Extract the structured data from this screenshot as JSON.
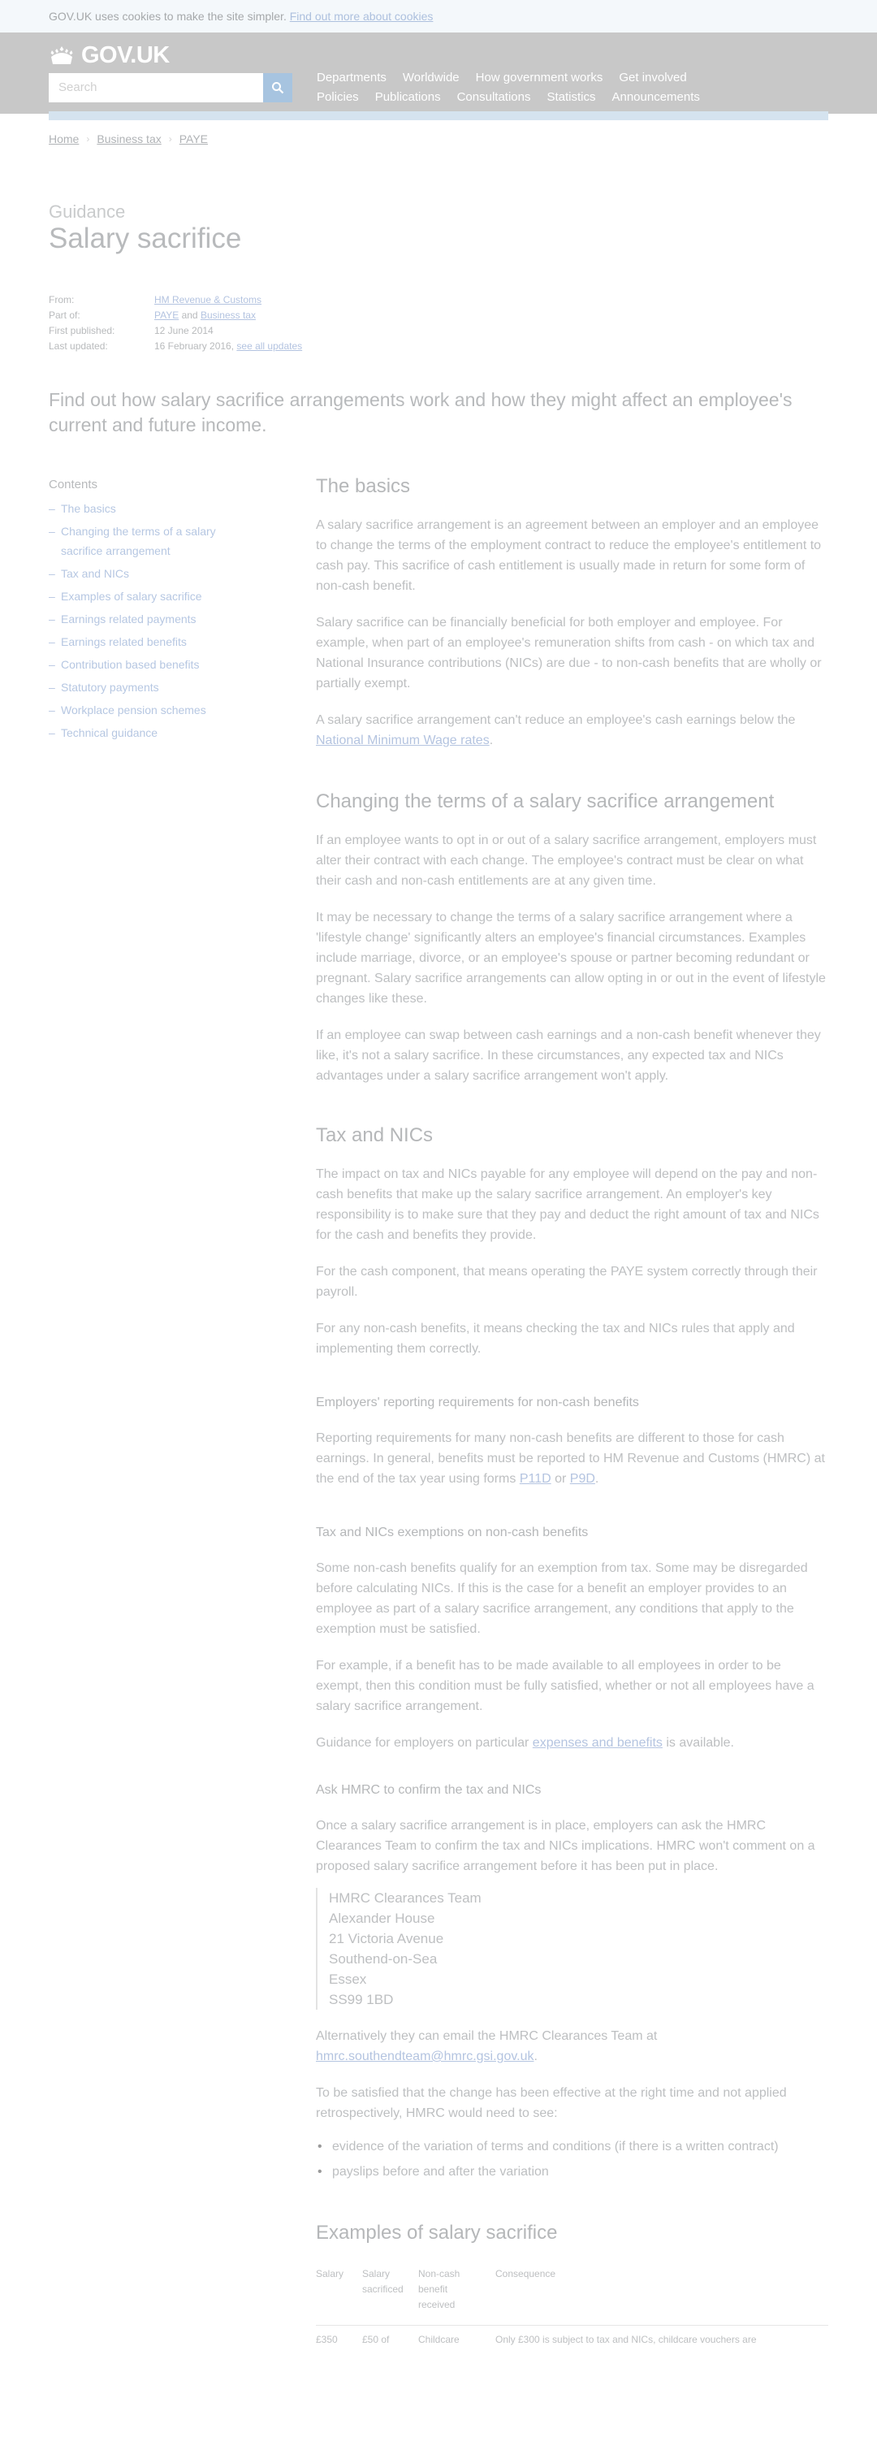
{
  "cookie_banner": {
    "text": "GOV.UK uses cookies to make the site simpler.",
    "link": "Find out more about cookies"
  },
  "header": {
    "logo_text": "GOV.UK",
    "logo_icon": "crown-icon",
    "search_placeholder": "Search",
    "search_icon": "magnifier-icon",
    "nav_row1": [
      "Departments",
      "Worldwide",
      "How government works",
      "Get involved"
    ],
    "nav_row2": [
      "Policies",
      "Publications",
      "Consultations",
      "Statistics",
      "Announcements"
    ]
  },
  "breadcrumb": [
    "Home",
    "Business tax",
    "PAYE"
  ],
  "page": {
    "kicker": "Guidance",
    "title": "Salary sacrifice"
  },
  "metadata": {
    "from_label": "From:",
    "from_value": "HM Revenue & Customs",
    "part_of_label": "Part of:",
    "part_of_link1": "PAYE",
    "part_of_and": " and ",
    "part_of_link2": "Business tax",
    "first_published_label": "First published:",
    "first_published_value": "12 June 2014",
    "last_updated_label": "Last updated:",
    "last_updated_value": "16 February 2016, ",
    "last_updated_link": "see all updates"
  },
  "lede": "Find out how salary sacrifice arrangements work and how they might affect an employee's current and future income.",
  "contents": {
    "heading": "Contents",
    "items": [
      "The basics",
      "Changing the terms of a salary sacrifice arrangement",
      "Tax and NICs",
      "Examples of salary sacrifice",
      "Earnings related payments",
      "Earnings related benefits",
      "Contribution based benefits",
      "Statutory payments",
      "Workplace pension schemes",
      "Technical guidance"
    ]
  },
  "basics": {
    "heading": "The basics",
    "p1": "A salary sacrifice arrangement is an agreement between an employer and an employee to change the terms of the employment contract to reduce the employee's entitlement to cash pay. This sacrifice of cash entitlement is usually made in return for some form of non-cash benefit.",
    "p2": "Salary sacrifice can be financially beneficial for both employer and employee. For example, when part of an employee's remuneration shifts from cash - on which tax and National Insurance contributions (NICs) are due - to non-cash benefits that are wholly or partially exempt.",
    "p3_before": "A salary sacrifice arrangement can't reduce an employee's cash earnings below the ",
    "p3_link": "National Minimum Wage rates",
    "p3_after": "."
  },
  "changing": {
    "heading": "Changing the terms of a salary sacrifice arrangement",
    "p1": "If an employee wants to opt in or out of a salary sacrifice arrangement, employers must alter their contract with each change. The employee's contract must be clear on what their cash and non-cash entitlements are at any given time.",
    "p2": "It may be necessary to change the terms of a salary sacrifice arrangement where a 'lifestyle change' significantly alters an employee's financial circumstances. Examples include marriage, divorce, or an employee's spouse or partner becoming redundant or pregnant. Salary sacrifice arrangements can allow opting in or out in the event of lifestyle changes like these.",
    "p3": "If an employee can swap between cash earnings and a non-cash benefit whenever they like, it's not a salary sacrifice. In these circumstances, any expected tax and NICs advantages under a salary sacrifice arrangement won't apply."
  },
  "tax": {
    "heading": "Tax and NICs",
    "p1": "The impact on tax and NICs payable for any employee will depend on the pay and non-cash benefits that make up the salary sacrifice arrangement. An employer's key responsibility is to make sure that they pay and deduct the right amount of tax and NICs for the cash and benefits they provide.",
    "p2": "For the cash component, that means operating the PAYE system correctly through their payroll.",
    "p3": "For any non-cash benefits, it means checking the tax and NICs rules that apply and implementing them correctly.",
    "reporting_heading": "Employers' reporting requirements for non-cash benefits",
    "reporting_p_before": "Reporting requirements for many non-cash benefits are different to those for cash earnings. In general, benefits must be reported to HM Revenue and Customs (HMRC) at the end of the tax year using forms ",
    "reporting_link1": "P11D",
    "reporting_or": " or ",
    "reporting_link2": "P9D",
    "reporting_after": ".",
    "exemptions_heading": "Tax and NICs exemptions on non-cash benefits",
    "exemptions_p1": "Some non-cash benefits qualify for an exemption from tax. Some may be disregarded before calculating NICs. If this is the case for a benefit an employer provides to an employee as part of a salary sacrifice arrangement, any conditions that apply to the exemption must be satisfied.",
    "exemptions_p2": "For example, if a benefit has to be made available to all employees in order to be exempt, then this condition must be fully satisfied, whether or not all employees have a salary sacrifice arrangement.",
    "exemptions_p3_before": "Guidance for employers on particular ",
    "exemptions_p3_link": "expenses and benefits",
    "exemptions_p3_after": " is available.",
    "ask_heading": "Ask HMRC to confirm the tax and NICs",
    "ask_p1": "Once a salary sacrifice arrangement is in place, employers can ask the HMRC Clearances Team to confirm the tax and NICs implications. HMRC won't comment on a proposed salary sacrifice arrangement before it has been put in place.",
    "address": [
      "HMRC Clearances Team",
      "Alexander House",
      "21 Victoria Avenue",
      "Southend-on-Sea",
      "Essex",
      "SS99 1BD"
    ],
    "email_p_before": "Alternatively they can email the HMRC Clearances Team at ",
    "email_link": "hmrc.southendteam@hmrc.gsi.gov.uk",
    "email_after": ".",
    "satisfied_p": "To be satisfied that the change has been effective at the right time and not applied retrospectively, HMRC would need to see:",
    "bullets": [
      "evidence of the variation of terms and conditions (if there is a written contract)",
      "payslips before and after the variation"
    ]
  },
  "examples": {
    "heading": "Examples of salary sacrifice",
    "columns": [
      "Salary",
      "Salary sacrificed",
      "Non-cash benefit received",
      "Consequence"
    ],
    "row1": [
      "£350",
      "£50 of",
      "Childcare",
      "Only £300 is subject to tax and NICs, childcare vouchers are"
    ]
  }
}
